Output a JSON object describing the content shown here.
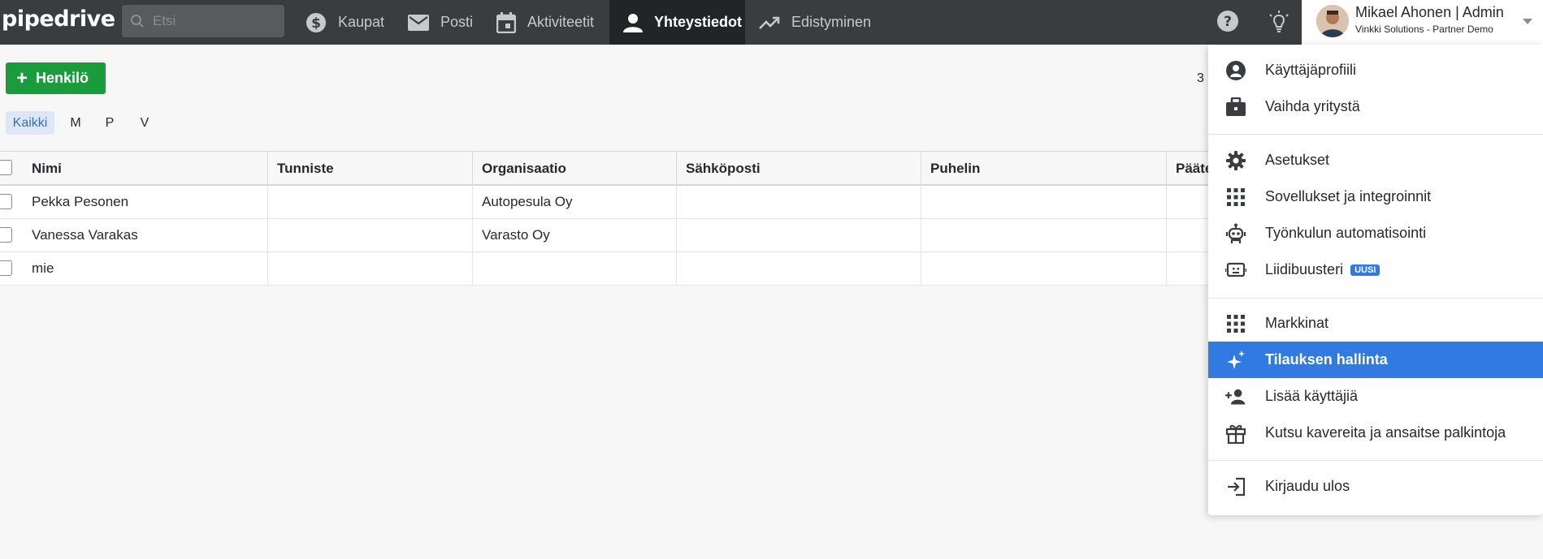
{
  "topbar": {
    "logo": "pipedrive",
    "search_placeholder": "Etsi",
    "nav": [
      {
        "label": "Kaupat",
        "icon": "dollar-icon"
      },
      {
        "label": "Posti",
        "icon": "mail-icon"
      },
      {
        "label": "Aktiviteetit",
        "icon": "calendar-icon"
      },
      {
        "label": "Yhteystiedot",
        "icon": "person-icon",
        "active": true
      },
      {
        "label": "Edistyminen",
        "icon": "trending-up-icon"
      }
    ],
    "user": {
      "name": "Mikael Ahonen | Admin",
      "company": "Vinkki Solutions - Partner Demo"
    }
  },
  "toolbar": {
    "add_label": "Henkilö",
    "count": "3",
    "filters": [
      "Kaikki",
      "M",
      "P",
      "V"
    ],
    "active_filter": "Kaikki"
  },
  "table": {
    "columns": [
      "Nimi",
      "Tunniste",
      "Organisaatio",
      "Sähköposti",
      "Puhelin",
      "Pääte"
    ],
    "rows": [
      {
        "name": "Pekka Pesonen",
        "label": "",
        "org": "Autopesula Oy",
        "email": "",
        "phone": ""
      },
      {
        "name": "Vanessa Varakas",
        "label": "",
        "org": "Varasto Oy",
        "email": "",
        "phone": ""
      },
      {
        "name": "mie",
        "label": "",
        "org": "",
        "email": "",
        "phone": ""
      }
    ]
  },
  "menu": {
    "items": [
      {
        "label": "Käyttäjäprofiili",
        "icon": "user-circle-icon"
      },
      {
        "label": "Vaihda yritystä",
        "icon": "briefcase-icon"
      },
      {
        "label": "Asetukset",
        "icon": "gear-icon"
      },
      {
        "label": "Sovellukset ja integroinnit",
        "icon": "apps-grid-icon"
      },
      {
        "label": "Työnkulun automatisointi",
        "icon": "robot-icon"
      },
      {
        "label": "Liidibuusteri",
        "icon": "chatbot-icon",
        "badge": "UUSI"
      },
      {
        "label": "Markkinat",
        "icon": "marketplace-grid-icon"
      },
      {
        "label": "Tilauksen hallinta",
        "icon": "sparkle-icon",
        "highlighted": true
      },
      {
        "label": "Lisää käyttäjiä",
        "icon": "add-user-icon"
      },
      {
        "label": "Kutsu kavereita ja ansaitse palkintoja",
        "icon": "gift-icon"
      },
      {
        "label": "Kirjaudu ulos",
        "icon": "logout-icon"
      }
    ]
  },
  "colors": {
    "topbar": "#3a3d40",
    "accent_green": "#1a9b3c",
    "highlight_blue": "#317ae2"
  }
}
